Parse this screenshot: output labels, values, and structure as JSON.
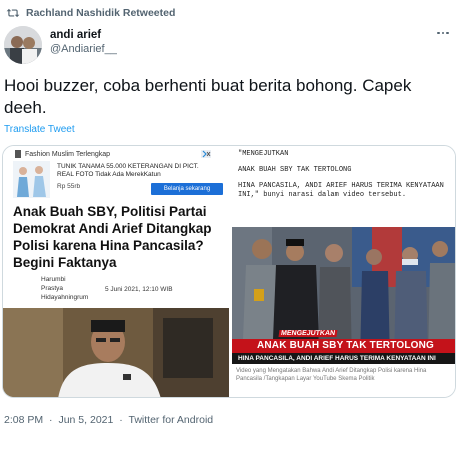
{
  "retweet": {
    "text": "Rachland Nashidik Retweeted",
    "icon": "retweet-icon"
  },
  "author": {
    "name": "andi arief",
    "handle": "@Andiarief__"
  },
  "tweet": {
    "text": "Hooi buzzer, coba berhenti buat berita bohong. Capek deeh.",
    "translate_label": "Translate Tweet"
  },
  "media": {
    "left": {
      "ad_header": "Fashion Muslim Terlengkap",
      "ad_line1": "TUNIK TANAMA 55.000 KETERANGAN DI PICT.",
      "ad_line2": "REAL FOTO Tidak Ada MerekKatun",
      "ad_price": "Rp 55rb",
      "ad_button": "Belanja sekarang",
      "headline": "Anak Buah SBY, Politisi Partai Demokrat Andi Arief Ditangkap Polisi karena Hina Pancasila? Begini Faktanya",
      "byline_1": "Harumbi",
      "byline_2": "Prastya",
      "byline_3": "Hidayahningrum",
      "date": "5 Juni 2021, 12:10 WIB"
    },
    "right": {
      "quote_1": "\"MENGEJUTKAN",
      "quote_2": "ANAK BUAH SBY TAK TERTOLONG",
      "quote_3": "HINA PANCASILA, ANDI ARIEF HARUS TERIMA KENYATAAN INI,\" bunyi narasi dalam video tersebut.",
      "banner_small": "MENGEJUTKAN",
      "banner_big": "ANAK BUAH SBY TAK TERTOLONG",
      "banner_sub": "HINA PANCASILA, ANDI ARIEF HARUS TERIMA KENYATAAN INI",
      "caption": "Video yang Mengatakan Bahwa Andi Arief Ditangkap Polisi karena Hina Pancasila /Tangkapan Layar YouTube Skema Politik"
    }
  },
  "footer": {
    "time": "2:08 PM",
    "separator": "·",
    "date": "Jun 5, 2021",
    "separator2": "·",
    "source": "Twitter for Android"
  },
  "colors": {
    "link": "#1d9bf0",
    "muted": "#536471",
    "banner_red": "#c4121a"
  }
}
